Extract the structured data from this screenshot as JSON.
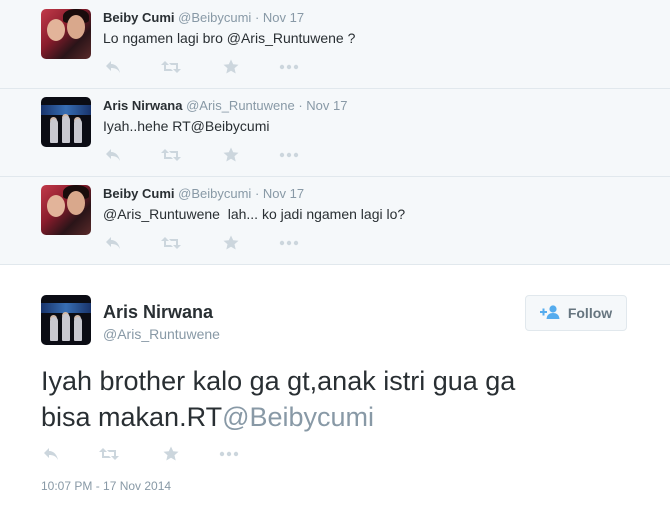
{
  "replies": [
    {
      "fullname": "Beiby Cumi",
      "username": "@Beibycumi",
      "separator": "·",
      "time": "Nov 17",
      "text": "Lo ngamen lagi bro @Aris_Runtuwene ?",
      "avatar": "beiby"
    },
    {
      "fullname": "Aris Nirwana",
      "username": "@Aris_Runtuwene",
      "separator": "·",
      "time": "Nov 17",
      "text": "Iyah..hehe RT@Beibycumi",
      "avatar": "aris"
    },
    {
      "fullname": "Beiby Cumi",
      "username": "@Beibycumi",
      "separator": "·",
      "time": "Nov 17",
      "text": "@Aris_Runtuwene  lah... ko jadi ngamen lagi lo?",
      "avatar": "beiby"
    }
  ],
  "main": {
    "fullname": "Aris Nirwana",
    "username": "@Aris_Runtuwene",
    "follow_label": "Follow",
    "text_line1": "Iyah brother kalo ga gt,anak istri gua ga",
    "text_line2_prefix": "bisa makan.RT",
    "text_line2_mention": "@Beibycumi",
    "timestamp": "10:07 PM - 17 Nov 2014"
  },
  "icons": {
    "reply": "reply-icon",
    "retweet": "retweet-icon",
    "favorite": "star-icon",
    "more": "more-icon",
    "follow": "follow-person-icon"
  },
  "colors": {
    "text": "#292f33",
    "muted": "#8899a6",
    "action_icon": "#ccd6dd",
    "reply_bg": "#f5f8fa",
    "border": "#e1e8ed",
    "follow_icon": "#55acee"
  }
}
